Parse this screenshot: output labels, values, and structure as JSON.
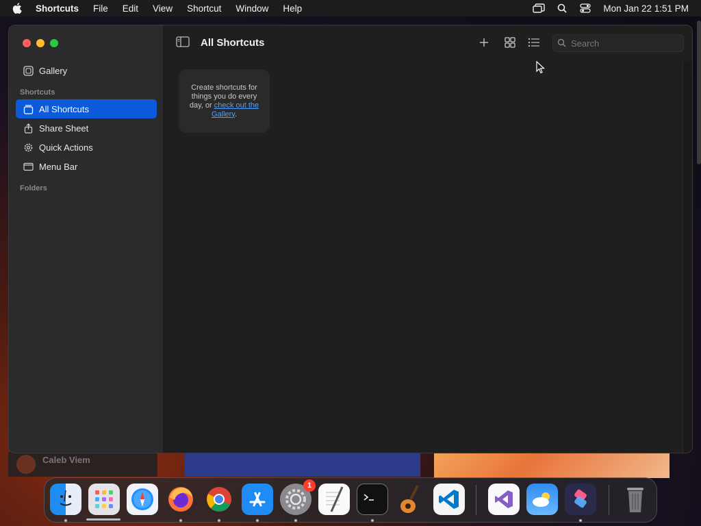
{
  "menubar": {
    "app_name": "Shortcuts",
    "items": [
      "File",
      "Edit",
      "View",
      "Shortcut",
      "Window",
      "Help"
    ],
    "clock": "Mon Jan 22  1:51 PM"
  },
  "sidebar": {
    "gallery": "Gallery",
    "section_shortcuts": "Shortcuts",
    "items": [
      {
        "label": "All Shortcuts",
        "icon": "collection-icon",
        "active": true
      },
      {
        "label": "Share Sheet",
        "icon": "share-icon",
        "active": false
      },
      {
        "label": "Quick Actions",
        "icon": "gear-icon",
        "active": false
      },
      {
        "label": "Menu Bar",
        "icon": "menubar-icon",
        "active": false
      }
    ],
    "section_folders": "Folders"
  },
  "toolbar": {
    "title": "All Shortcuts",
    "search_placeholder": "Search"
  },
  "empty_state": {
    "text_before": "Create shortcuts for things you do every day, or ",
    "link_text": "check out the Gallery",
    "text_after": "."
  },
  "background": {
    "left_strip_name": "Caleb Viem"
  },
  "dock": {
    "apps": [
      "Finder",
      "Launchpad",
      "Safari",
      "Firefox",
      "Chrome",
      "App Store",
      "System Settings",
      "TextEdit",
      "Terminal",
      "GarageBand",
      "Visual Studio Code",
      "Visual Studio",
      "Weather",
      "Shortcuts",
      "Trash"
    ],
    "settings_badge": "1"
  },
  "colors": {
    "accent": "#0a5ad9",
    "link": "#4ea1ff",
    "traffic_red": "#ff5f57",
    "traffic_yellow": "#febc2e",
    "traffic_green": "#28c840"
  }
}
